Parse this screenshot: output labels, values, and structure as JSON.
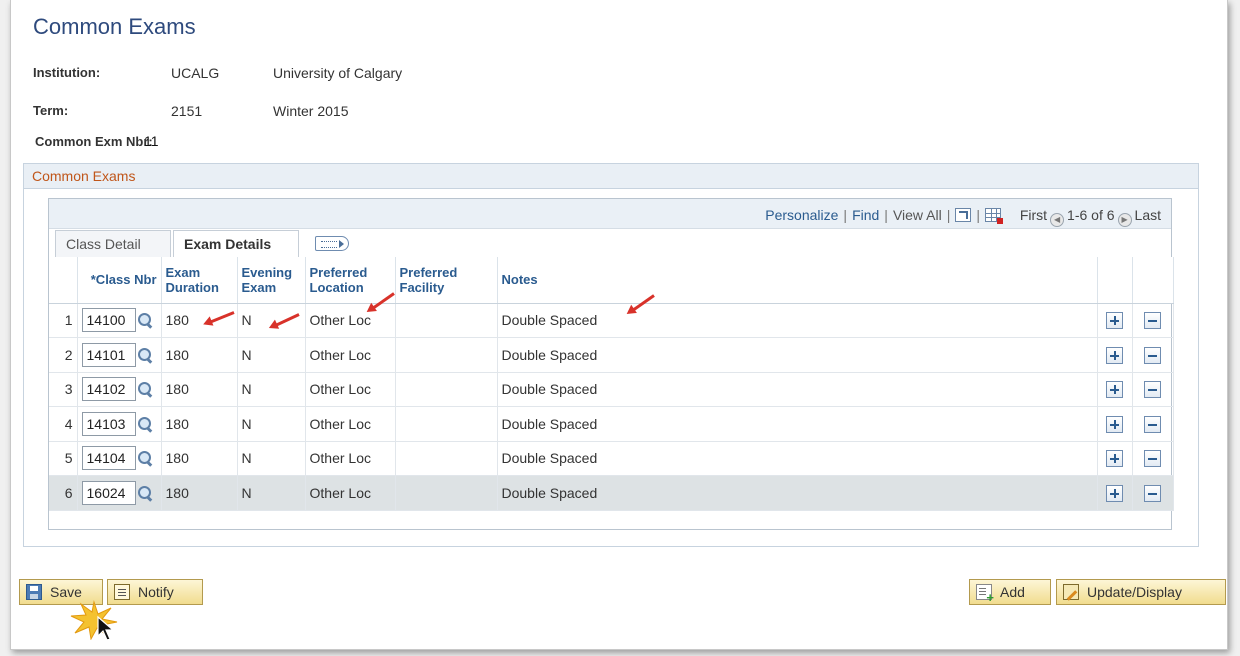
{
  "page": {
    "title": "Common Exams"
  },
  "fields": {
    "institution": {
      "label": "Institution:",
      "code": "UCALG",
      "description": "University of Calgary"
    },
    "term": {
      "label": "Term:",
      "code": "2151",
      "description": "Winter 2015"
    },
    "common_exm_nbr": {
      "label": "Common Exm Nbr:",
      "value": "11"
    }
  },
  "group": {
    "title": "Common Exams"
  },
  "grid_nav": {
    "personalize": "Personalize",
    "find": "Find",
    "view_all": "View All",
    "first": "First",
    "range": "1-6 of 6",
    "last": "Last",
    "zoom_icon": "zoom-icon",
    "download_icon": "download-grid-icon"
  },
  "tabs": [
    {
      "label": "Class Detail",
      "active": false
    },
    {
      "label": "Exam Details",
      "active": true
    }
  ],
  "table": {
    "columns": {
      "class_nbr": "*Class Nbr",
      "exam_duration": "Exam Duration",
      "evening_exam": "Evening Exam",
      "preferred_location": "Preferred Location",
      "preferred_facility": "Preferred Facility",
      "notes": "Notes"
    },
    "rows": [
      {
        "num": "1",
        "class_nbr": "14100",
        "exam_duration": "180",
        "evening_exam": "N",
        "preferred_location": "Other Loc",
        "preferred_facility": "",
        "notes": "Double Spaced"
      },
      {
        "num": "2",
        "class_nbr": "14101",
        "exam_duration": "180",
        "evening_exam": "N",
        "preferred_location": "Other Loc",
        "preferred_facility": "",
        "notes": "Double Spaced"
      },
      {
        "num": "3",
        "class_nbr": "14102",
        "exam_duration": "180",
        "evening_exam": "N",
        "preferred_location": "Other Loc",
        "preferred_facility": "",
        "notes": "Double Spaced"
      },
      {
        "num": "4",
        "class_nbr": "14103",
        "exam_duration": "180",
        "evening_exam": "N",
        "preferred_location": "Other Loc",
        "preferred_facility": "",
        "notes": "Double Spaced"
      },
      {
        "num": "5",
        "class_nbr": "14104",
        "exam_duration": "180",
        "evening_exam": "N",
        "preferred_location": "Other Loc",
        "preferred_facility": "",
        "notes": "Double Spaced"
      },
      {
        "num": "6",
        "class_nbr": "16024",
        "exam_duration": "180",
        "evening_exam": "N",
        "preferred_location": "Other Loc",
        "preferred_facility": "",
        "notes": "Double Spaced"
      }
    ]
  },
  "buttons": {
    "save": "Save",
    "notify": "Notify",
    "add": "Add",
    "update_display": "Update/Display"
  },
  "colors": {
    "title": "#2e4a7d",
    "link": "#2a5b8f",
    "group_title": "#c0561a",
    "annotation_arrow": "#d8322a",
    "button_bg": "#f1dc8e"
  }
}
